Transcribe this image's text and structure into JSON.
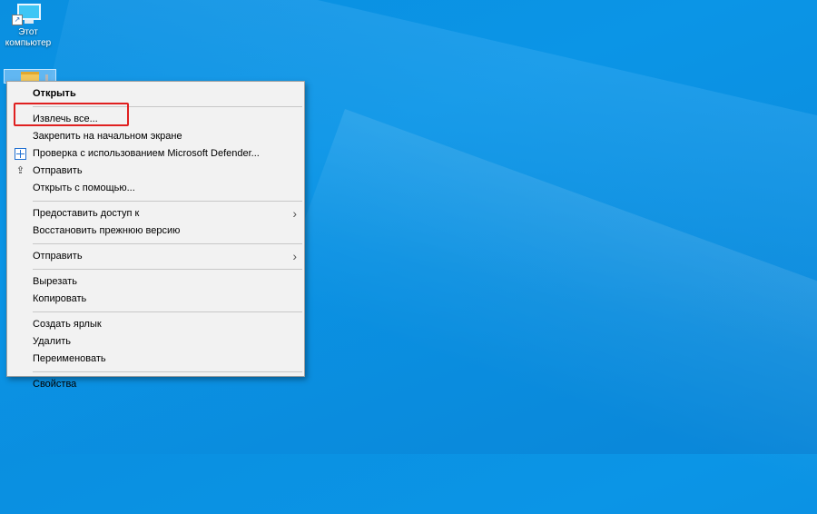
{
  "desktop": {
    "this_pc_label": "Этот\nкомпьютер"
  },
  "context_menu": {
    "open": "Открыть",
    "extract_all": "Извлечь все...",
    "pin_start": "Закрепить на начальном экране",
    "defender_scan": "Проверка с использованием Microsoft Defender...",
    "share": "Отправить",
    "open_with": "Открыть с помощью...",
    "give_access": "Предоставить доступ к",
    "restore_previous": "Восстановить прежнюю версию",
    "send_to": "Отправить",
    "cut": "Вырезать",
    "copy": "Копировать",
    "create_shortcut": "Создать ярлык",
    "delete": "Удалить",
    "rename": "Переименовать",
    "properties": "Свойства"
  },
  "icons": {
    "defender": "shield-scan-icon",
    "share": "share-icon",
    "submenu": "chevron-right-icon"
  },
  "colors": {
    "highlight_box": "#e02020",
    "desktop_blue": "#0a8fe0"
  }
}
